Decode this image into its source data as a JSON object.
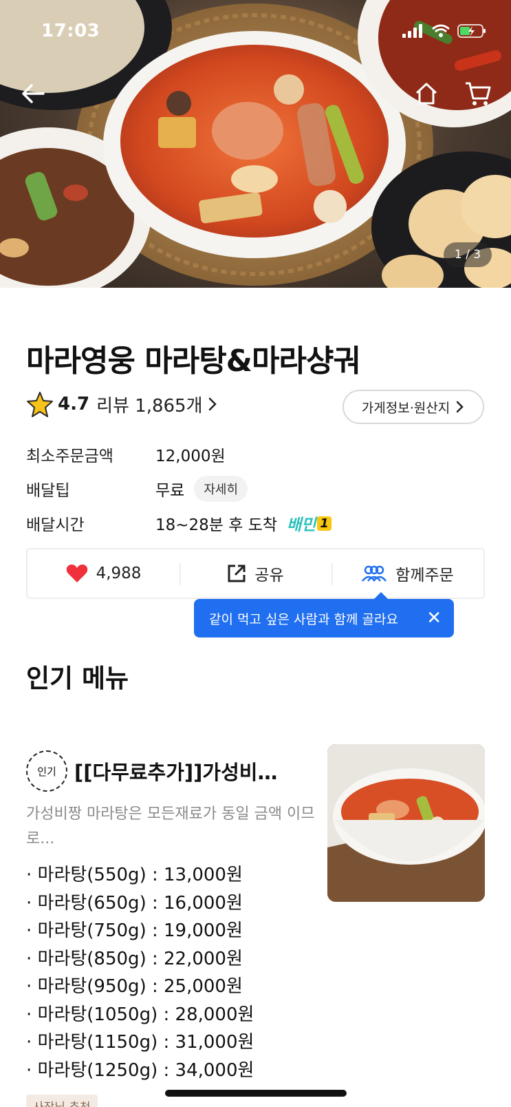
{
  "status_bar": {
    "time": "17:03"
  },
  "hero": {
    "counter": "1 / 3"
  },
  "store": {
    "name": "마라영웅 마라탕&마라샹궈",
    "rating": "4.7",
    "review_text": "리뷰 1,865개",
    "info_button": "가게정보·원산지"
  },
  "info": {
    "min_order_label": "최소주문금액",
    "min_order_value": "12,000원",
    "tip_label": "배달팁",
    "tip_value": "무료",
    "tip_detail": "자세히",
    "time_label": "배달시간",
    "time_value": "18~28분 후 도착",
    "baemin_text": "배민",
    "baemin_num": "1"
  },
  "actions": {
    "like_count": "4,988",
    "share": "공유",
    "group_order": "함께주문"
  },
  "tooltip": {
    "text": "같이 먹고 싶은 사람과 함께 골라요"
  },
  "section": {
    "popular_title": "인기 메뉴"
  },
  "menu": {
    "badge": "인기",
    "name": "[[다무료추가]]가성비…",
    "desc": "가성비짱 마라탕은 모든재료가 동일 금액 이므로...",
    "prices": [
      "· 마라탕(550g) : 13,000원",
      "· 마라탕(650g) : 16,000원",
      "· 마라탕(750g) : 19,000원",
      "· 마라탕(850g) : 22,000원",
      "· 마라탕(950g) : 25,000원",
      "· 마라탕(1050g) : 28,000원",
      "· 마라탕(1150g) : 31,000원",
      "· 마라탕(1250g) : 34,000원"
    ],
    "owner_tag": "사장님 추천"
  },
  "colors": {
    "accent_blue": "#1f6ff0",
    "heart_red": "#f0313c",
    "baemin_mint": "#2ac1bc",
    "star_yellow": "#f7c21a"
  },
  "icons": [
    "back-arrow-icon",
    "home-icon",
    "cart-icon",
    "star-icon",
    "chevron-right-icon",
    "heart-icon",
    "share-icon",
    "group-icon",
    "close-icon"
  ]
}
